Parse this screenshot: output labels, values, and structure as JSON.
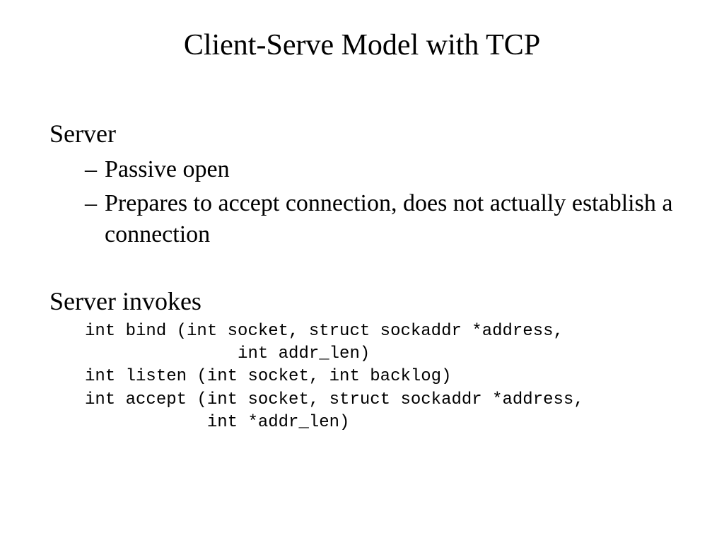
{
  "title": "Client-Serve Model with TCP",
  "section1": {
    "heading": "Server",
    "bullets": [
      "Passive open",
      "Prepares to accept connection, does not actually establish a connection"
    ]
  },
  "section2": {
    "heading": "Server invokes",
    "code": "int bind (int socket, struct sockaddr *address,\n               int addr_len)\nint listen (int socket, int backlog)\nint accept (int socket, struct sockaddr *address,\n            int *addr_len)"
  }
}
